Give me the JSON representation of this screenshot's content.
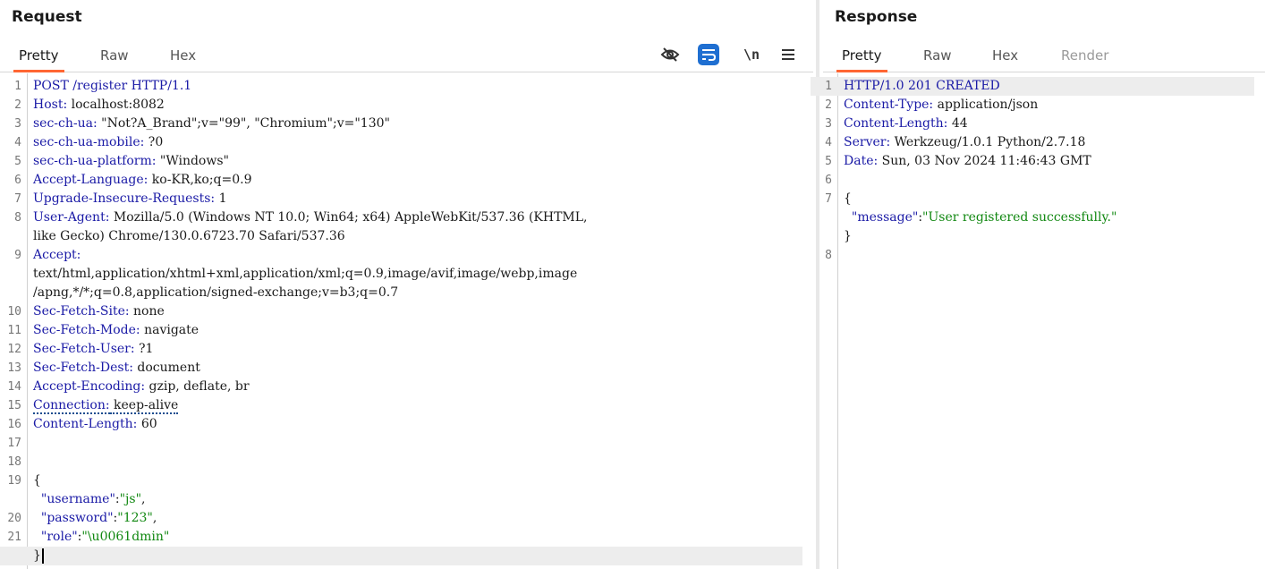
{
  "request": {
    "title": "Request",
    "tabs": [
      "Pretty",
      "Raw",
      "Hex"
    ],
    "active_tab": "Pretty",
    "toolbar": [
      "eye-slash-icon",
      "wrap-lines-icon",
      "newline-icon",
      "menu-icon"
    ],
    "toolbar_newline_label": "\\n",
    "lines": [
      {
        "n": "1",
        "k": "POST /register HTTP/1.1",
        "v": ""
      },
      {
        "n": "2",
        "k": "Host:",
        "v": " localhost:8082"
      },
      {
        "n": "3",
        "k": "sec-ch-ua:",
        "v": " \"Not?A_Brand\";v=\"99\", \"Chromium\";v=\"130\""
      },
      {
        "n": "4",
        "k": "sec-ch-ua-mobile:",
        "v": " ?0"
      },
      {
        "n": "5",
        "k": "sec-ch-ua-platform:",
        "v": " \"Windows\""
      },
      {
        "n": "6",
        "k": "Accept-Language:",
        "v": " ko-KR,ko;q=0.9"
      },
      {
        "n": "7",
        "k": "Upgrade-Insecure-Requests:",
        "v": " 1"
      },
      {
        "n": "8",
        "k": "User-Agent:",
        "v": " Mozilla/5.0 (Windows NT 10.0; Win64; x64) AppleWebKit/537.36 (KHTML,"
      },
      {
        "n": "",
        "k": "",
        "v": "like Gecko) Chrome/130.0.6723.70 Safari/537.36"
      },
      {
        "n": "9",
        "k": "Accept:",
        "v": ""
      },
      {
        "n": "",
        "k": "",
        "v": "text/html,application/xhtml+xml,application/xml;q=0.9,image/avif,image/webp,image"
      },
      {
        "n": "",
        "k": "",
        "v": "/apng,*/*;q=0.8,application/signed-exchange;v=b3;q=0.7"
      },
      {
        "n": "10",
        "k": "Sec-Fetch-Site:",
        "v": " none"
      },
      {
        "n": "11",
        "k": "Sec-Fetch-Mode:",
        "v": " navigate"
      },
      {
        "n": "12",
        "k": "Sec-Fetch-User:",
        "v": " ?1"
      },
      {
        "n": "13",
        "k": "Sec-Fetch-Dest:",
        "v": " document"
      },
      {
        "n": "14",
        "k": "Accept-Encoding:",
        "v": " gzip, deflate, br"
      },
      {
        "n": "15",
        "k": "Connection:",
        "v": " keep-alive"
      },
      {
        "n": "16",
        "k": "Content-Length:",
        "v": " 60"
      },
      {
        "n": "17",
        "k": "",
        "v": ""
      },
      {
        "n": "18",
        "k": "",
        "v": ""
      },
      {
        "n": "19",
        "k": "",
        "v": "{"
      },
      {
        "n": "",
        "jk": "  \"username\"",
        "jp": ":",
        "js": "\"js\"",
        "jt": ","
      },
      {
        "n": "20",
        "jk": "  \"password\"",
        "jp": ":",
        "js": "\"123\"",
        "jt": ","
      },
      {
        "n": "21",
        "jk": "  \"role\"",
        "jp": ":",
        "js": "\"\\u0061dmin\"",
        "jt": ""
      },
      {
        "n": "",
        "k": "",
        "v": "}"
      }
    ]
  },
  "response": {
    "title": "Response",
    "tabs": [
      "Pretty",
      "Raw",
      "Hex",
      "Render"
    ],
    "active_tab": "Pretty",
    "lines": [
      {
        "n": "1",
        "k": "HTTP/1.0 201 CREATED",
        "v": ""
      },
      {
        "n": "2",
        "k": "Content-Type:",
        "v": " application/json"
      },
      {
        "n": "3",
        "k": "Content-Length:",
        "v": " 44"
      },
      {
        "n": "4",
        "k": "Server:",
        "v": " Werkzeug/1.0.1 Python/2.7.18"
      },
      {
        "n": "5",
        "k": "Date:",
        "v": " Sun, 03 Nov 2024 11:46:43 GMT"
      },
      {
        "n": "6",
        "k": "",
        "v": ""
      },
      {
        "n": "7",
        "k": "",
        "v": "{"
      },
      {
        "n": "",
        "jk": "  \"message\"",
        "jp": ":",
        "js": "\"User registered successfully.\"",
        "jt": ""
      },
      {
        "n": "",
        "k": "",
        "v": "}"
      },
      {
        "n": "8",
        "k": "",
        "v": ""
      }
    ]
  },
  "colors": {
    "accent": "#ff6633",
    "header_key": "#1a1aa6",
    "json_string": "#118811",
    "wrap_button": "#1f6fd1"
  }
}
